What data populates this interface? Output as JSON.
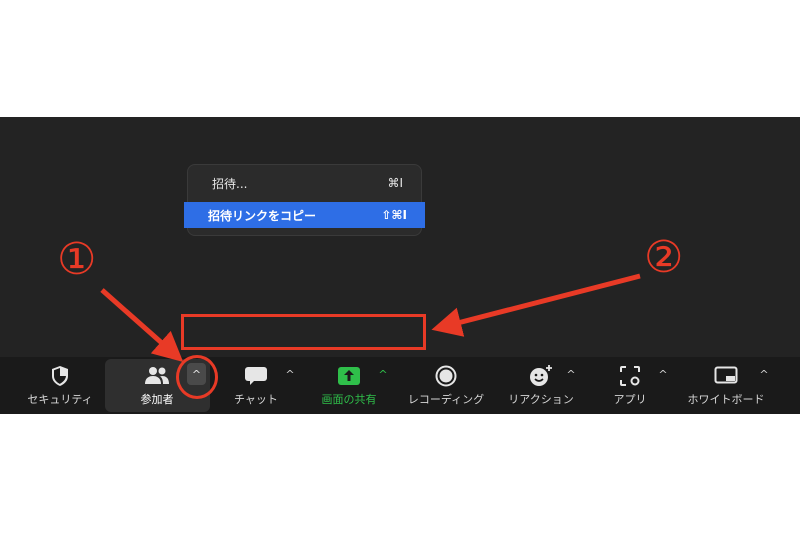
{
  "colors": {
    "accent": "#2e6ee6",
    "annotation": "#e83a26",
    "share_green": "#2fbf4a",
    "toolbar_bg": "#1a1a1a"
  },
  "annotations": {
    "marker_1": "①",
    "marker_2": "②"
  },
  "menu": {
    "invite_label": "招待...",
    "invite_shortcut": "⌘I",
    "copy_label": "招待リンクをコピー",
    "copy_shortcut": "⇧⌘I"
  },
  "toolbar": {
    "security": {
      "label": "セキュリティ",
      "icon": "shield-icon"
    },
    "participants": {
      "label": "参加者",
      "icon": "people-icon"
    },
    "chat": {
      "label": "チャット",
      "icon": "chat-bubble-icon"
    },
    "share": {
      "label": "画面の共有",
      "icon": "share-arrow-icon"
    },
    "record": {
      "label": "レコーディング",
      "icon": "record-icon"
    },
    "reactions": {
      "label": "リアクション",
      "icon": "smiley-plus-icon"
    },
    "apps": {
      "label": "アプリ",
      "icon": "apps-icon"
    },
    "whiteboard": {
      "label": "ホワイトボード",
      "icon": "whiteboard-icon"
    },
    "caret": "^"
  }
}
